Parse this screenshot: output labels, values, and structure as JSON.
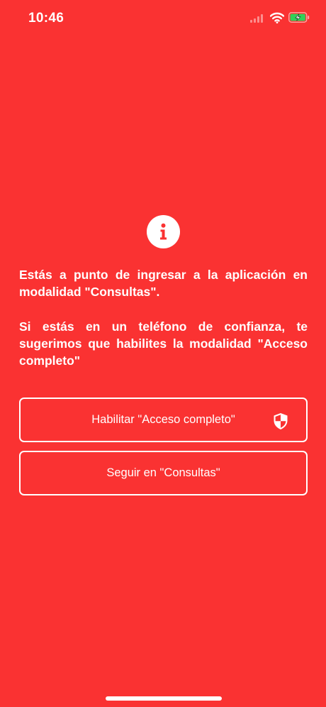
{
  "status_bar": {
    "time": "10:46",
    "signal_icon": "cellular-signal-icon",
    "wifi_icon": "wifi-icon",
    "battery_icon": "battery-charging-icon",
    "battery_color": "#30D158"
  },
  "colors": {
    "background": "#FA3232",
    "foreground": "#FFFFFF"
  },
  "info": {
    "icon": "info-icon",
    "message_1": "Estás a punto de ingresar a la aplicación en modalidad \"Consultas\".",
    "message_2": "Si estás en un teléfono de confianza, te sugerimos que habilites la modalidad \"Acceso completo\""
  },
  "buttons": {
    "full_access_label": "Habilitar \"Acceso completo\"",
    "full_access_icon": "shield-icon",
    "consult_label": "Seguir en \"Consultas\""
  }
}
